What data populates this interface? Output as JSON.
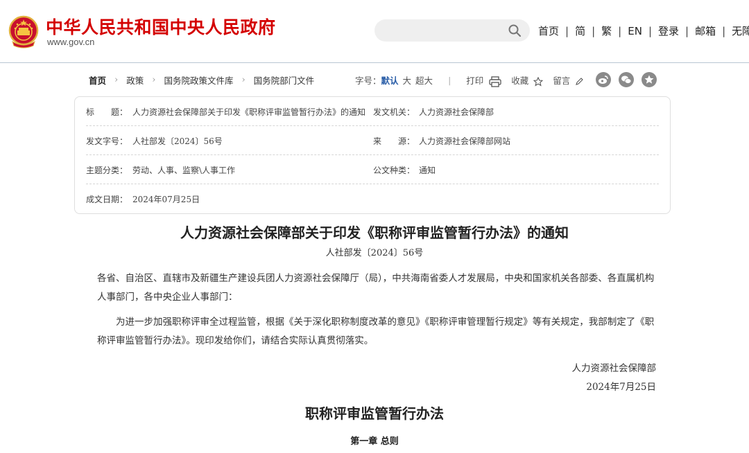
{
  "header": {
    "site_title": "中华人民共和国中央人民政府",
    "site_url": "www.gov.cn",
    "search": {
      "placeholder": ""
    },
    "nav": [
      "首页",
      "简",
      "繁",
      "EN",
      "登录",
      "邮箱",
      "无障碍"
    ]
  },
  "breadcrumb": [
    "首页",
    "政策",
    "国务院政策文件库",
    "国务院部门文件"
  ],
  "toolbar": {
    "font_label": "字号：",
    "font_sizes": [
      "默认",
      "大",
      "超大"
    ],
    "print": "打印",
    "favorite": "收藏",
    "comment": "留言",
    "share_icons": [
      "weibo-icon",
      "wechat-icon",
      "star-icon"
    ]
  },
  "meta": {
    "title_label": "标　　题：",
    "title_value": "人力资源社会保障部关于印发《职称评审监管暂行办法》的通知",
    "issuer_label": "发文机关：",
    "issuer_value": "人力资源社会保障部",
    "docno_label": "发文字号：",
    "docno_value": "人社部发〔2024〕56号",
    "source_label": "来　　源：",
    "source_value": "人力资源社会保障部网站",
    "category_label": "主题分类：",
    "category_value": "劳动、人事、监察\\人事工作",
    "type_label": "公文种类：",
    "type_value": "通知",
    "date_label": "成文日期：",
    "date_value": "2024年07月25日"
  },
  "article": {
    "title": "人力资源社会保障部关于印发《职称评审监管暂行办法》的通知",
    "doc_number": "人社部发〔2024〕56号",
    "recipients": "各省、自治区、直辖市及新疆生产建设兵团人力资源社会保障厅（局），中共海南省委人才发展局，中央和国家机关各部委、各直属机构人事部门，各中央企业人事部门：",
    "body": "为进一步加强职称评审全过程监管，根据《关于深化职称制度改革的意见》《职称评审管理暂行规定》等有关规定，我部制定了《职称评审监管暂行办法》。现印发给你们，请结合实际认真贯彻落实。",
    "signer": "人力资源社会保障部",
    "sign_date": "2024年7月25日",
    "subtitle": "职称评审监管暂行办法",
    "chapter": "第一章  总则"
  },
  "colors": {
    "brand_red": "#d40000",
    "link_blue": "#2c5fa8"
  }
}
